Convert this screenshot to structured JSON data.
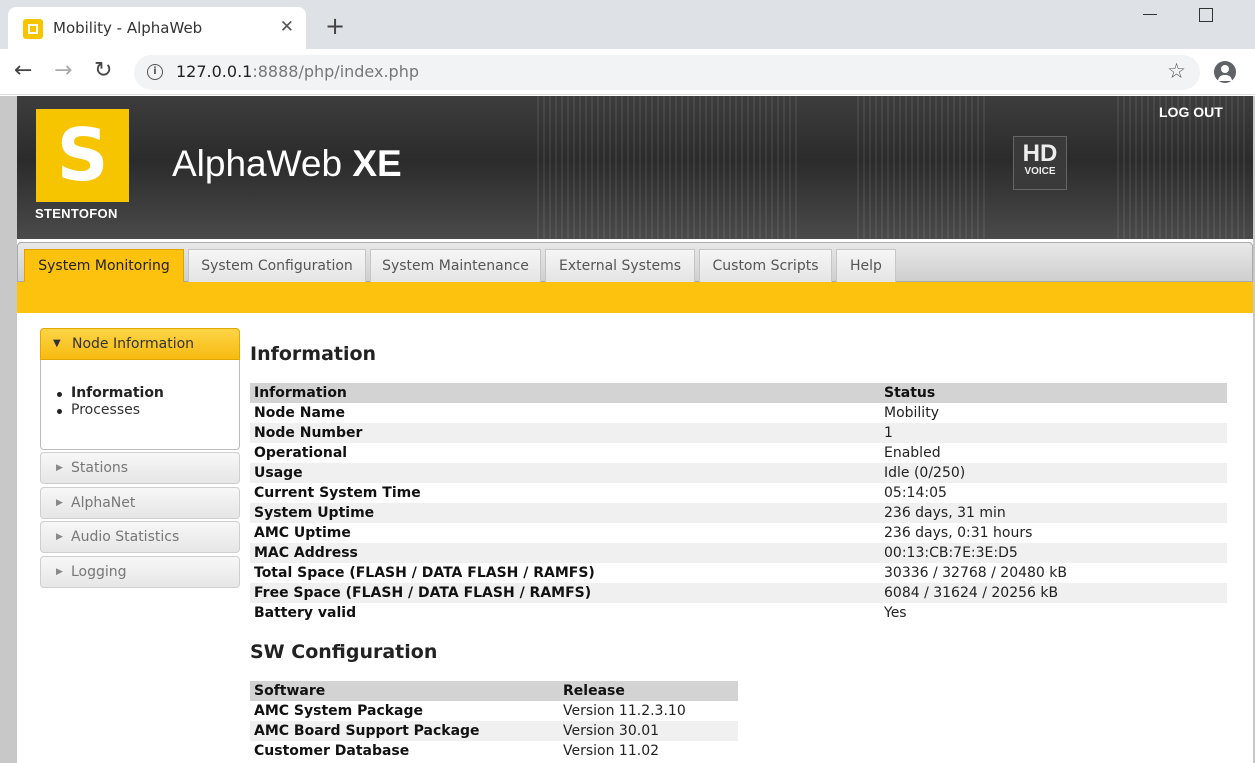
{
  "browser": {
    "tab_title": "Mobility - AlphaWeb",
    "tab_close": "✕",
    "new_tab": "+",
    "url_host": "127.0.0.1",
    "url_rest": ":8888/php/index.php",
    "info_glyph": "i",
    "star_glyph": "☆",
    "back_glyph": "←",
    "forward_glyph": "→",
    "reload_glyph": "↻"
  },
  "banner": {
    "logo_letter": "S",
    "logo_text": "STENTOFON",
    "brand_light": "AlphaWeb ",
    "brand_bold": "XE",
    "hd": "HD",
    "voice": "VOICE",
    "logout": "LOG OUT"
  },
  "tabs": [
    {
      "label": "System Monitoring",
      "active": true
    },
    {
      "label": "System Configuration",
      "active": false
    },
    {
      "label": "System Maintenance",
      "active": false
    },
    {
      "label": "External Systems",
      "active": false
    },
    {
      "label": "Custom Scripts",
      "active": false
    },
    {
      "label": "Help",
      "active": false
    }
  ],
  "sidebar": {
    "expanded": {
      "label": "Node Information",
      "items": [
        "Information",
        "Processes"
      ]
    },
    "collapsed": [
      "Stations",
      "AlphaNet",
      "Audio Statistics",
      "Logging"
    ]
  },
  "information": {
    "heading": "Information",
    "col1": "Information",
    "col2": "Status",
    "rows": [
      {
        "k": "Node Name",
        "v": "Mobility"
      },
      {
        "k": "Node Number",
        "v": "1"
      },
      {
        "k": "Operational",
        "v": "Enabled"
      },
      {
        "k": "Usage",
        "v": "Idle (0/250)"
      },
      {
        "k": "Current System Time",
        "v": "05:14:05"
      },
      {
        "k": "System Uptime",
        "v": "236 days, 31 min"
      },
      {
        "k": "AMC Uptime",
        "v": "236 days, 0:31 hours"
      },
      {
        "k": "MAC Address",
        "v": "00:13:CB:7E:3E:D5"
      },
      {
        "k": "Total Space (FLASH / DATA FLASH / RAMFS)",
        "v": "30336 / 32768 / 20480 kB"
      },
      {
        "k": "Free Space (FLASH / DATA FLASH / RAMFS)",
        "v": "6084 / 31624 / 20256 kB"
      },
      {
        "k": "Battery valid",
        "v": "Yes"
      }
    ]
  },
  "sw": {
    "heading": "SW Configuration",
    "col1": "Software",
    "col2": "Release",
    "rows": [
      {
        "k": "AMC System Package",
        "v": "Version 11.2.3.10"
      },
      {
        "k": "AMC Board Support Package",
        "v": "Version 30.01"
      },
      {
        "k": "Customer Database",
        "v": "Version 11.02"
      }
    ]
  },
  "colors": {
    "accent_yellow": "#fcc20d",
    "banner_dark": "#2b2b2b",
    "row_alt": "#f0f0f0",
    "header_gray": "#d3d3d3"
  }
}
